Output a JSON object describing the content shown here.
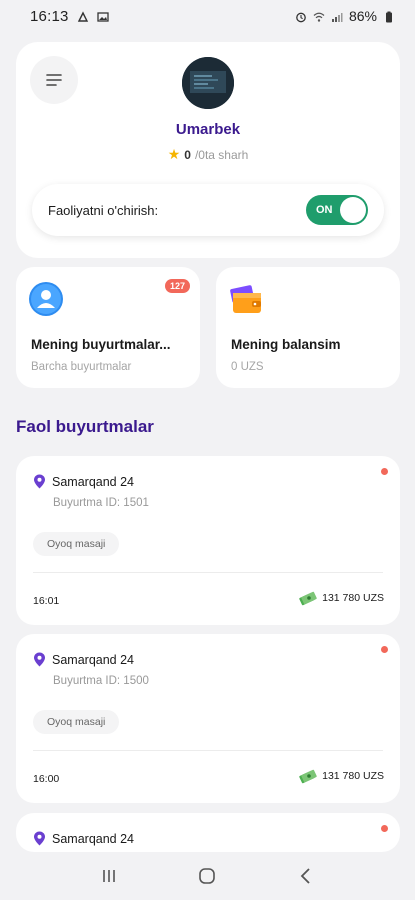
{
  "status_bar": {
    "time": "16:13",
    "battery": "86%"
  },
  "profile": {
    "name": "Umarbek",
    "rating": "0",
    "reviews": "/0ta sharh",
    "activity_label": "Faoliyatni o'chirish:",
    "toggle_text": "ON"
  },
  "tiles": {
    "orders": {
      "title": "Mening buyurtmalar...",
      "subtitle": "Barcha buyurtmalar",
      "badge": "127"
    },
    "balance": {
      "title": "Mening balansim",
      "subtitle": "0 UZS"
    }
  },
  "section_title": "Faol buyurtmalar",
  "orders": [
    {
      "address": "Samarqand 24",
      "order_id": "Buyurtma ID: 1501",
      "service": "Oyoq masaji",
      "time": "16:01",
      "price": "131 780 UZS"
    },
    {
      "address": "Samarqand 24",
      "order_id": "Buyurtma ID: 1500",
      "service": "Oyoq masaji",
      "time": "16:00",
      "price": "131 780 UZS"
    },
    {
      "address": "Samarqand 24"
    }
  ],
  "colors": {
    "accent": "#3b1a8e",
    "toggle_on": "#1f9d6c",
    "badge": "#f2685a",
    "star": "#f5b400"
  }
}
